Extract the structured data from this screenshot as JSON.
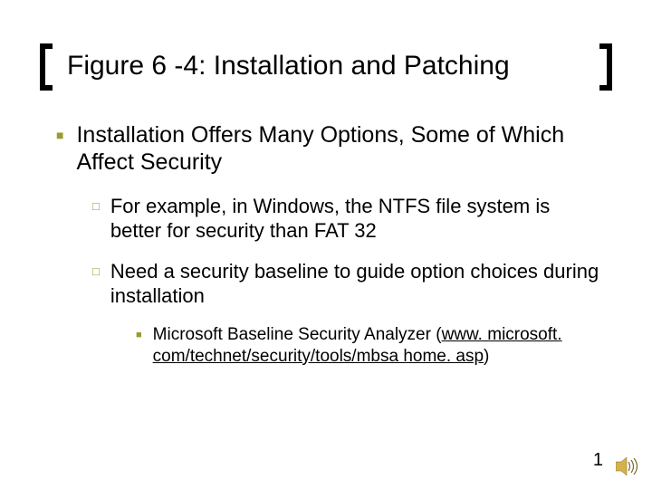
{
  "title": "Figure 6 -4: Installation and Patching",
  "lvl1_text": "Installation Offers Many Options, Some of Which Affect Security",
  "lvl2_items": [
    "For example, in Windows, the NTFS file system is better for security than FAT 32",
    "Need a security baseline to guide option choices during installation"
  ],
  "lvl3_prefix": "Microsoft Baseline Security Analyzer (",
  "lvl3_link": "www. microsoft. com/technet/security/tools/mbsa home. asp",
  "lvl3_suffix": ")",
  "page_number": "1"
}
